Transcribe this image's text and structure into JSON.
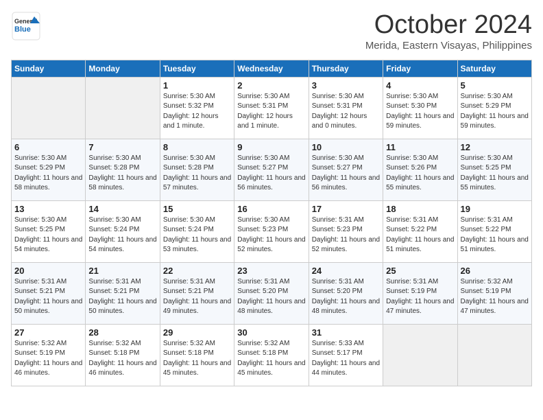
{
  "header": {
    "logo_line1": "General",
    "logo_line2": "Blue",
    "month_title": "October 2024",
    "location": "Merida, Eastern Visayas, Philippines"
  },
  "weekdays": [
    "Sunday",
    "Monday",
    "Tuesday",
    "Wednesday",
    "Thursday",
    "Friday",
    "Saturday"
  ],
  "weeks": [
    [
      {
        "day": "",
        "sunrise": "",
        "sunset": "",
        "daylight": ""
      },
      {
        "day": "",
        "sunrise": "",
        "sunset": "",
        "daylight": ""
      },
      {
        "day": "1",
        "sunrise": "Sunrise: 5:30 AM",
        "sunset": "Sunset: 5:32 PM",
        "daylight": "Daylight: 12 hours and 1 minute."
      },
      {
        "day": "2",
        "sunrise": "Sunrise: 5:30 AM",
        "sunset": "Sunset: 5:31 PM",
        "daylight": "Daylight: 12 hours and 1 minute."
      },
      {
        "day": "3",
        "sunrise": "Sunrise: 5:30 AM",
        "sunset": "Sunset: 5:31 PM",
        "daylight": "Daylight: 12 hours and 0 minutes."
      },
      {
        "day": "4",
        "sunrise": "Sunrise: 5:30 AM",
        "sunset": "Sunset: 5:30 PM",
        "daylight": "Daylight: 11 hours and 59 minutes."
      },
      {
        "day": "5",
        "sunrise": "Sunrise: 5:30 AM",
        "sunset": "Sunset: 5:29 PM",
        "daylight": "Daylight: 11 hours and 59 minutes."
      }
    ],
    [
      {
        "day": "6",
        "sunrise": "Sunrise: 5:30 AM",
        "sunset": "Sunset: 5:29 PM",
        "daylight": "Daylight: 11 hours and 58 minutes."
      },
      {
        "day": "7",
        "sunrise": "Sunrise: 5:30 AM",
        "sunset": "Sunset: 5:28 PM",
        "daylight": "Daylight: 11 hours and 58 minutes."
      },
      {
        "day": "8",
        "sunrise": "Sunrise: 5:30 AM",
        "sunset": "Sunset: 5:28 PM",
        "daylight": "Daylight: 11 hours and 57 minutes."
      },
      {
        "day": "9",
        "sunrise": "Sunrise: 5:30 AM",
        "sunset": "Sunset: 5:27 PM",
        "daylight": "Daylight: 11 hours and 56 minutes."
      },
      {
        "day": "10",
        "sunrise": "Sunrise: 5:30 AM",
        "sunset": "Sunset: 5:27 PM",
        "daylight": "Daylight: 11 hours and 56 minutes."
      },
      {
        "day": "11",
        "sunrise": "Sunrise: 5:30 AM",
        "sunset": "Sunset: 5:26 PM",
        "daylight": "Daylight: 11 hours and 55 minutes."
      },
      {
        "day": "12",
        "sunrise": "Sunrise: 5:30 AM",
        "sunset": "Sunset: 5:25 PM",
        "daylight": "Daylight: 11 hours and 55 minutes."
      }
    ],
    [
      {
        "day": "13",
        "sunrise": "Sunrise: 5:30 AM",
        "sunset": "Sunset: 5:25 PM",
        "daylight": "Daylight: 11 hours and 54 minutes."
      },
      {
        "day": "14",
        "sunrise": "Sunrise: 5:30 AM",
        "sunset": "Sunset: 5:24 PM",
        "daylight": "Daylight: 11 hours and 54 minutes."
      },
      {
        "day": "15",
        "sunrise": "Sunrise: 5:30 AM",
        "sunset": "Sunset: 5:24 PM",
        "daylight": "Daylight: 11 hours and 53 minutes."
      },
      {
        "day": "16",
        "sunrise": "Sunrise: 5:30 AM",
        "sunset": "Sunset: 5:23 PM",
        "daylight": "Daylight: 11 hours and 52 minutes."
      },
      {
        "day": "17",
        "sunrise": "Sunrise: 5:31 AM",
        "sunset": "Sunset: 5:23 PM",
        "daylight": "Daylight: 11 hours and 52 minutes."
      },
      {
        "day": "18",
        "sunrise": "Sunrise: 5:31 AM",
        "sunset": "Sunset: 5:22 PM",
        "daylight": "Daylight: 11 hours and 51 minutes."
      },
      {
        "day": "19",
        "sunrise": "Sunrise: 5:31 AM",
        "sunset": "Sunset: 5:22 PM",
        "daylight": "Daylight: 11 hours and 51 minutes."
      }
    ],
    [
      {
        "day": "20",
        "sunrise": "Sunrise: 5:31 AM",
        "sunset": "Sunset: 5:21 PM",
        "daylight": "Daylight: 11 hours and 50 minutes."
      },
      {
        "day": "21",
        "sunrise": "Sunrise: 5:31 AM",
        "sunset": "Sunset: 5:21 PM",
        "daylight": "Daylight: 11 hours and 50 minutes."
      },
      {
        "day": "22",
        "sunrise": "Sunrise: 5:31 AM",
        "sunset": "Sunset: 5:21 PM",
        "daylight": "Daylight: 11 hours and 49 minutes."
      },
      {
        "day": "23",
        "sunrise": "Sunrise: 5:31 AM",
        "sunset": "Sunset: 5:20 PM",
        "daylight": "Daylight: 11 hours and 48 minutes."
      },
      {
        "day": "24",
        "sunrise": "Sunrise: 5:31 AM",
        "sunset": "Sunset: 5:20 PM",
        "daylight": "Daylight: 11 hours and 48 minutes."
      },
      {
        "day": "25",
        "sunrise": "Sunrise: 5:31 AM",
        "sunset": "Sunset: 5:19 PM",
        "daylight": "Daylight: 11 hours and 47 minutes."
      },
      {
        "day": "26",
        "sunrise": "Sunrise: 5:32 AM",
        "sunset": "Sunset: 5:19 PM",
        "daylight": "Daylight: 11 hours and 47 minutes."
      }
    ],
    [
      {
        "day": "27",
        "sunrise": "Sunrise: 5:32 AM",
        "sunset": "Sunset: 5:19 PM",
        "daylight": "Daylight: 11 hours and 46 minutes."
      },
      {
        "day": "28",
        "sunrise": "Sunrise: 5:32 AM",
        "sunset": "Sunset: 5:18 PM",
        "daylight": "Daylight: 11 hours and 46 minutes."
      },
      {
        "day": "29",
        "sunrise": "Sunrise: 5:32 AM",
        "sunset": "Sunset: 5:18 PM",
        "daylight": "Daylight: 11 hours and 45 minutes."
      },
      {
        "day": "30",
        "sunrise": "Sunrise: 5:32 AM",
        "sunset": "Sunset: 5:18 PM",
        "daylight": "Daylight: 11 hours and 45 minutes."
      },
      {
        "day": "31",
        "sunrise": "Sunrise: 5:33 AM",
        "sunset": "Sunset: 5:17 PM",
        "daylight": "Daylight: 11 hours and 44 minutes."
      },
      {
        "day": "",
        "sunrise": "",
        "sunset": "",
        "daylight": ""
      },
      {
        "day": "",
        "sunrise": "",
        "sunset": "",
        "daylight": ""
      }
    ]
  ]
}
